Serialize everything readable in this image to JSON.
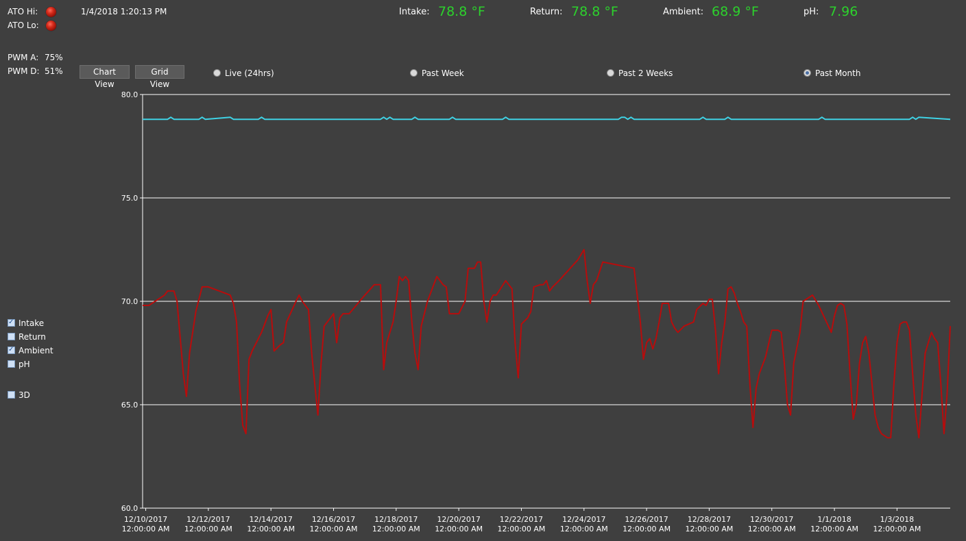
{
  "status": {
    "ato_hi_label": "ATO Hi:",
    "ato_lo_label": "ATO Lo:",
    "timestamp": "1/4/2018 1:20:13 PM",
    "pwm_a_label": "PWM A:",
    "pwm_a_value": "75%",
    "pwm_d_label": "PWM D:",
    "pwm_d_value": "51%"
  },
  "readings": {
    "intake_label": "Intake:",
    "intake_value": "78.8 °F",
    "return_label": "Return:",
    "return_value": "78.8 °F",
    "ambient_label": "Ambient:",
    "ambient_value": "68.9 °F",
    "ph_label": "pH:",
    "ph_value": "7.96",
    "value_color": "#2cd12c"
  },
  "views": {
    "chart_view_label": "Chart View",
    "grid_view_label": "Grid View"
  },
  "ranges": {
    "live_label": "Live (24hrs)",
    "week_label": "Past Week",
    "two_weeks_label": "Past 2 Weeks",
    "month_label": "Past Month",
    "selected": "Past Month"
  },
  "series_toggles": {
    "intake_label": "Intake",
    "intake_checked": true,
    "return_label": "Return",
    "return_checked": false,
    "ambient_label": "Ambient",
    "ambient_checked": true,
    "ph_label": "pH",
    "ph_checked": false,
    "three_d_label": "3D",
    "three_d_checked": false
  },
  "chart_data": {
    "type": "line",
    "ylim": [
      60,
      80
    ],
    "y_ticks": [
      "80.0",
      "75.0",
      "70.0",
      "65.0",
      "60.0"
    ],
    "x_range_days": [
      -0.1,
      25.7
    ],
    "x_tick_labels": [
      [
        "12/10/2017",
        "12:00:00 AM"
      ],
      [
        "12/12/2017",
        "12:00:00 AM"
      ],
      [
        "12/14/2017",
        "12:00:00 AM"
      ],
      [
        "12/16/2017",
        "12:00:00 AM"
      ],
      [
        "12/18/2017",
        "12:00:00 AM"
      ],
      [
        "12/20/2017",
        "12:00:00 AM"
      ],
      [
        "12/22/2017",
        "12:00:00 AM"
      ],
      [
        "12/24/2017",
        "12:00:00 AM"
      ],
      [
        "12/26/2017",
        "12:00:00 AM"
      ],
      [
        "12/28/2017",
        "12:00:00 AM"
      ],
      [
        "12/30/2017",
        "12:00:00 AM"
      ],
      [
        "1/1/2018",
        "12:00:00 AM"
      ],
      [
        "1/3/2018",
        "12:00:00 AM"
      ]
    ],
    "series": [
      {
        "name": "Intake",
        "color": "#3fd3e6",
        "points": [
          [
            -0.1,
            78.8
          ],
          [
            0.7,
            78.8
          ],
          [
            0.8,
            78.9
          ],
          [
            0.9,
            78.8
          ],
          [
            1.7,
            78.8
          ],
          [
            1.8,
            78.9
          ],
          [
            1.9,
            78.8
          ],
          [
            2.7,
            78.9
          ],
          [
            2.8,
            78.8
          ],
          [
            3.6,
            78.8
          ],
          [
            3.7,
            78.9
          ],
          [
            3.8,
            78.8
          ],
          [
            7.5,
            78.8
          ],
          [
            7.6,
            78.9
          ],
          [
            7.7,
            78.8
          ],
          [
            7.8,
            78.9
          ],
          [
            7.9,
            78.8
          ],
          [
            8.5,
            78.8
          ],
          [
            8.6,
            78.9
          ],
          [
            8.7,
            78.8
          ],
          [
            9.7,
            78.8
          ],
          [
            9.8,
            78.9
          ],
          [
            9.9,
            78.8
          ],
          [
            11.4,
            78.8
          ],
          [
            11.5,
            78.9
          ],
          [
            11.6,
            78.8
          ],
          [
            15.1,
            78.8
          ],
          [
            15.2,
            78.9
          ],
          [
            15.3,
            78.9
          ],
          [
            15.4,
            78.8
          ],
          [
            15.5,
            78.9
          ],
          [
            15.6,
            78.8
          ],
          [
            17.7,
            78.8
          ],
          [
            17.8,
            78.9
          ],
          [
            17.9,
            78.8
          ],
          [
            18.5,
            78.8
          ],
          [
            18.6,
            78.9
          ],
          [
            18.7,
            78.8
          ],
          [
            21.5,
            78.8
          ],
          [
            21.6,
            78.9
          ],
          [
            21.7,
            78.8
          ],
          [
            24.4,
            78.8
          ],
          [
            24.5,
            78.9
          ],
          [
            24.6,
            78.8
          ],
          [
            24.7,
            78.9
          ],
          [
            25.7,
            78.8
          ]
        ]
      },
      {
        "name": "Ambient",
        "color": "#b80c0c",
        "points": [
          [
            -0.1,
            69.8
          ],
          [
            0.1,
            69.8
          ],
          [
            0.6,
            70.3
          ],
          [
            0.7,
            70.5
          ],
          [
            0.9,
            70.5
          ],
          [
            1.0,
            70.0
          ],
          [
            1.2,
            66.5
          ],
          [
            1.3,
            65.4
          ],
          [
            1.4,
            67.5
          ],
          [
            1.6,
            69.5
          ],
          [
            1.8,
            70.7
          ],
          [
            2.0,
            70.7
          ],
          [
            2.7,
            70.3
          ],
          [
            2.8,
            69.9
          ],
          [
            2.9,
            69.0
          ],
          [
            3.0,
            66.0
          ],
          [
            3.1,
            64.0
          ],
          [
            3.2,
            63.6
          ],
          [
            3.3,
            67.2
          ],
          [
            3.4,
            67.6
          ],
          [
            3.7,
            68.5
          ],
          [
            3.9,
            69.3
          ],
          [
            4.0,
            69.6
          ],
          [
            4.1,
            67.6
          ],
          [
            4.3,
            67.9
          ],
          [
            4.4,
            68.0
          ],
          [
            4.5,
            69.0
          ],
          [
            4.8,
            70.0
          ],
          [
            4.9,
            70.3
          ],
          [
            5.0,
            70.0
          ],
          [
            5.2,
            69.6
          ],
          [
            5.3,
            67.5
          ],
          [
            5.4,
            66.0
          ],
          [
            5.5,
            64.5
          ],
          [
            5.6,
            67.0
          ],
          [
            5.7,
            68.8
          ],
          [
            5.9,
            69.2
          ],
          [
            6.0,
            69.4
          ],
          [
            6.1,
            68.0
          ],
          [
            6.2,
            69.2
          ],
          [
            6.3,
            69.4
          ],
          [
            6.5,
            69.4
          ],
          [
            7.0,
            70.3
          ],
          [
            7.3,
            70.8
          ],
          [
            7.5,
            70.8
          ],
          [
            7.6,
            66.7
          ],
          [
            7.7,
            68.0
          ],
          [
            7.9,
            69.0
          ],
          [
            8.0,
            70.0
          ],
          [
            8.1,
            71.2
          ],
          [
            8.2,
            71.0
          ],
          [
            8.3,
            71.2
          ],
          [
            8.4,
            71.0
          ],
          [
            8.5,
            69.0
          ],
          [
            8.6,
            67.5
          ],
          [
            8.7,
            66.7
          ],
          [
            8.8,
            68.8
          ],
          [
            9.0,
            70.0
          ],
          [
            9.2,
            70.8
          ],
          [
            9.3,
            71.2
          ],
          [
            9.5,
            70.8
          ],
          [
            9.6,
            70.7
          ],
          [
            9.7,
            69.4
          ],
          [
            9.9,
            69.4
          ],
          [
            10.0,
            69.4
          ],
          [
            10.2,
            70.0
          ],
          [
            10.3,
            71.6
          ],
          [
            10.5,
            71.6
          ],
          [
            10.6,
            71.9
          ],
          [
            10.7,
            71.9
          ],
          [
            10.8,
            70.0
          ],
          [
            10.9,
            69.0
          ],
          [
            11.0,
            70.0
          ],
          [
            11.1,
            70.3
          ],
          [
            11.2,
            70.3
          ],
          [
            11.5,
            71.0
          ],
          [
            11.6,
            70.8
          ],
          [
            11.7,
            70.6
          ],
          [
            11.8,
            68.0
          ],
          [
            11.9,
            66.3
          ],
          [
            12.0,
            68.9
          ],
          [
            12.2,
            69.2
          ],
          [
            12.3,
            69.5
          ],
          [
            12.4,
            70.7
          ],
          [
            12.6,
            70.8
          ],
          [
            12.7,
            70.8
          ],
          [
            12.8,
            71.0
          ],
          [
            12.9,
            70.5
          ],
          [
            13.0,
            70.7
          ],
          [
            13.2,
            71.0
          ],
          [
            13.5,
            71.5
          ],
          [
            13.8,
            72.0
          ],
          [
            14.0,
            72.5
          ],
          [
            14.1,
            71.0
          ],
          [
            14.2,
            69.9
          ],
          [
            14.3,
            70.8
          ],
          [
            14.4,
            71.0
          ],
          [
            14.6,
            71.9
          ],
          [
            15.6,
            71.6
          ],
          [
            15.8,
            69.0
          ],
          [
            15.9,
            67.2
          ],
          [
            16.0,
            68.0
          ],
          [
            16.1,
            68.2
          ],
          [
            16.2,
            67.7
          ],
          [
            16.3,
            68.2
          ],
          [
            16.4,
            69.0
          ],
          [
            16.5,
            69.9
          ],
          [
            16.7,
            69.9
          ],
          [
            16.8,
            69.0
          ],
          [
            16.9,
            68.7
          ],
          [
            17.0,
            68.5
          ],
          [
            17.2,
            68.8
          ],
          [
            17.5,
            69.0
          ],
          [
            17.6,
            69.6
          ],
          [
            17.8,
            69.9
          ],
          [
            17.9,
            69.8
          ],
          [
            18.0,
            70.1
          ],
          [
            18.1,
            70.1
          ],
          [
            18.2,
            68.6
          ],
          [
            18.3,
            66.5
          ],
          [
            18.4,
            68.0
          ],
          [
            18.5,
            69.0
          ],
          [
            18.6,
            70.6
          ],
          [
            18.7,
            70.7
          ],
          [
            18.8,
            70.4
          ],
          [
            18.9,
            69.9
          ],
          [
            19.0,
            69.5
          ],
          [
            19.1,
            69.0
          ],
          [
            19.2,
            68.8
          ],
          [
            19.3,
            66.0
          ],
          [
            19.4,
            63.9
          ],
          [
            19.5,
            65.8
          ],
          [
            19.6,
            66.5
          ],
          [
            19.8,
            67.3
          ],
          [
            20.0,
            68.6
          ],
          [
            20.2,
            68.6
          ],
          [
            20.3,
            68.5
          ],
          [
            20.4,
            67.0
          ],
          [
            20.5,
            65.0
          ],
          [
            20.6,
            64.5
          ],
          [
            20.7,
            67.0
          ],
          [
            20.9,
            68.5
          ],
          [
            21.0,
            70.0
          ],
          [
            21.1,
            70.1
          ],
          [
            21.3,
            70.3
          ],
          [
            21.5,
            69.8
          ],
          [
            21.9,
            68.5
          ],
          [
            22.0,
            69.3
          ],
          [
            22.1,
            69.8
          ],
          [
            22.2,
            69.9
          ],
          [
            22.3,
            69.8
          ],
          [
            22.4,
            68.9
          ],
          [
            22.5,
            66.5
          ],
          [
            22.6,
            64.3
          ],
          [
            22.7,
            65.0
          ],
          [
            22.8,
            67.0
          ],
          [
            22.9,
            68.0
          ],
          [
            23.0,
            68.3
          ],
          [
            23.1,
            67.5
          ],
          [
            23.2,
            66.0
          ],
          [
            23.3,
            64.5
          ],
          [
            23.4,
            63.9
          ],
          [
            23.5,
            63.6
          ],
          [
            23.6,
            63.5
          ],
          [
            23.7,
            63.4
          ],
          [
            23.8,
            63.4
          ],
          [
            23.9,
            66.0
          ],
          [
            24.0,
            68.0
          ],
          [
            24.1,
            68.9
          ],
          [
            24.2,
            69.0
          ],
          [
            24.3,
            69.0
          ],
          [
            24.4,
            68.6
          ],
          [
            24.5,
            66.5
          ],
          [
            24.6,
            64.5
          ],
          [
            24.7,
            63.4
          ],
          [
            24.8,
            65.5
          ],
          [
            24.9,
            67.5
          ],
          [
            25.0,
            68.0
          ],
          [
            25.1,
            68.5
          ],
          [
            25.2,
            68.2
          ],
          [
            25.3,
            68.0
          ],
          [
            25.4,
            66.0
          ],
          [
            25.5,
            63.6
          ],
          [
            25.6,
            65.5
          ],
          [
            25.7,
            68.8
          ]
        ]
      }
    ],
    "grid": true
  }
}
